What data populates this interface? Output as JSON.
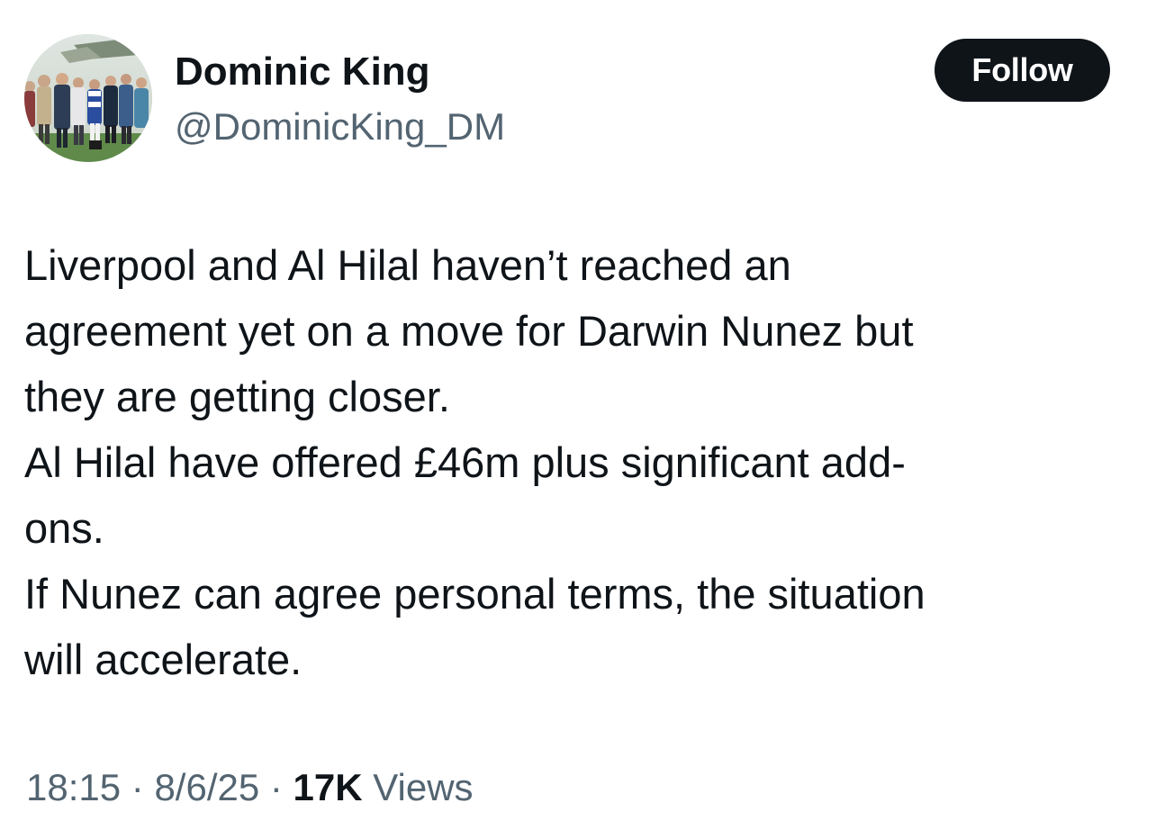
{
  "author": {
    "display_name": "Dominic King",
    "handle": "@DominicKing_DM",
    "avatar_icon": "profile-photo-crowd-at-racecourse"
  },
  "follow_button": {
    "label": "Follow",
    "background": "#0f1419",
    "text_color": "#ffffff"
  },
  "tweet": {
    "lines": [
      "Liverpool and Al Hilal haven’t reached an",
      "agreement yet on a move for Darwin Nunez but",
      "they are getting closer.",
      "Al Hilal have offered £46m plus significant add-",
      "ons.",
      "If Nunez can agree personal terms, the situation",
      "will accelerate."
    ]
  },
  "meta": {
    "time": "18:15",
    "separator": " · ",
    "date": "8/6/25",
    "views_count": "17K",
    "views_label": "Views"
  },
  "colors": {
    "text_primary": "#0f1419",
    "text_secondary": "#536471",
    "background": "#ffffff"
  }
}
